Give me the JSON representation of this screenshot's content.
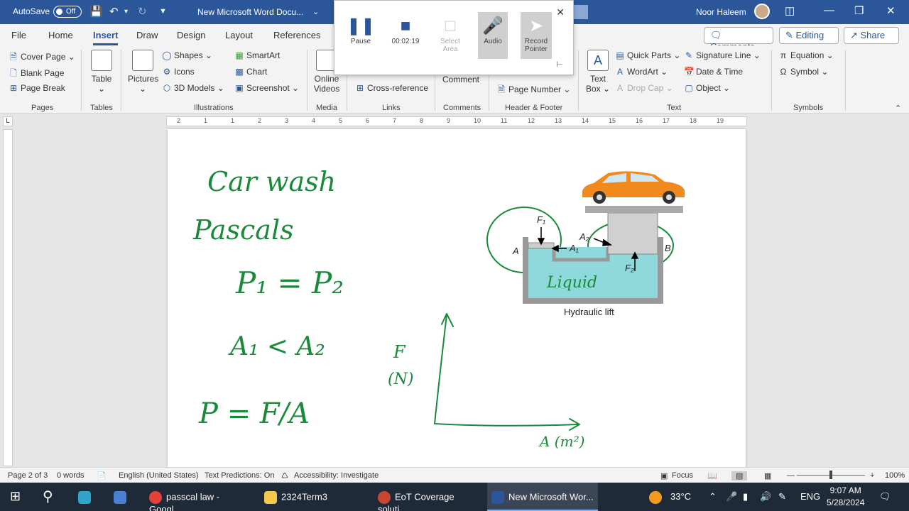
{
  "titlebar": {
    "autosave_label": "AutoSave",
    "autosave_state": "Off",
    "doc_title": "New Microsoft Word Docu...",
    "user_name": "Noor Haleem"
  },
  "tabs": [
    "File",
    "Home",
    "Insert",
    "Draw",
    "Design",
    "Layout",
    "References"
  ],
  "active_tab": "Insert",
  "header_buttons": {
    "comments": "Comments",
    "editing": "Editing",
    "share": "Share"
  },
  "ribbon": {
    "pages": {
      "cover": "Cover Page",
      "blank": "Blank Page",
      "break": "Page Break",
      "group": "Pages"
    },
    "tables": {
      "table": "Table",
      "group": "Tables"
    },
    "illustrations": {
      "pictures": "Pictures",
      "shapes": "Shapes",
      "icons": "Icons",
      "models": "3D Models",
      "smartart": "SmartArt",
      "chart": "Chart",
      "screenshot": "Screenshot",
      "group": "Illustrations"
    },
    "media": {
      "online_line1": "Online",
      "online_line2": "Videos",
      "group": "Media"
    },
    "links": {
      "crossref": "Cross-reference",
      "group": "Links"
    },
    "comments": {
      "comment": "Comment",
      "group": "Comments"
    },
    "header_footer": {
      "page_number": "Page Number",
      "group": "Header & Footer"
    },
    "text": {
      "textbox_line1": "Text",
      "textbox_line2": "Box",
      "quickparts": "Quick Parts",
      "wordart": "WordArt",
      "dropcap": "Drop Cap",
      "sigline": "Signature Line",
      "datetime": "Date & Time",
      "object": "Object",
      "group": "Text"
    },
    "symbols": {
      "equation": "Equation",
      "symbol": "Symbol",
      "group": "Symbols"
    }
  },
  "recorder": {
    "pause": "Pause",
    "time": "00:02:19",
    "select_area_line1": "Select",
    "select_area_line2": "Area",
    "audio": "Audio",
    "record_line1": "Record",
    "record_line2": "Pointer"
  },
  "ruler_ticks": [
    "2",
    "1",
    "1",
    "2",
    "3",
    "4",
    "5",
    "6",
    "7",
    "8",
    "9",
    "10",
    "11",
    "12",
    "13",
    "14",
    "15",
    "16",
    "17",
    "18",
    "19"
  ],
  "notes": {
    "title": "Car wash",
    "law": "Pascals",
    "eq1": "P₁ = P₂",
    "eq2": "A₁ < A₂",
    "eq3": "P = F/A",
    "graph_y": "F",
    "graph_y_unit": "(N)",
    "graph_x": "A (m²)",
    "liquid": "Liquid"
  },
  "diagram": {
    "caption": "Hydraulic lift",
    "label_a": "A",
    "label_b": "B",
    "label_f1": "F₁",
    "label_f2": "F₂",
    "label_a1": "A₁",
    "label_a2": "A₂"
  },
  "statusbar": {
    "page": "Page 2 of 3",
    "words": "0 words",
    "language": "English (United States)",
    "predictions": "Text Predictions: On",
    "accessibility": "Accessibility: Investigate",
    "focus": "Focus",
    "zoom": "100%"
  },
  "taskbar": {
    "chrome": "passcal law - Googl...",
    "folder": "2324Term3",
    "ppt": "EoT Coverage soluti...",
    "word": "New Microsoft Wor...",
    "temp": "33°C",
    "lang": "ENG",
    "time": "9:07 AM",
    "date": "5/28/2024"
  },
  "colors": {
    "word_blue": "#2b579a",
    "ink_green": "#1a8a3a",
    "liquid": "#8fd8dc",
    "car": "#f08a1e"
  }
}
